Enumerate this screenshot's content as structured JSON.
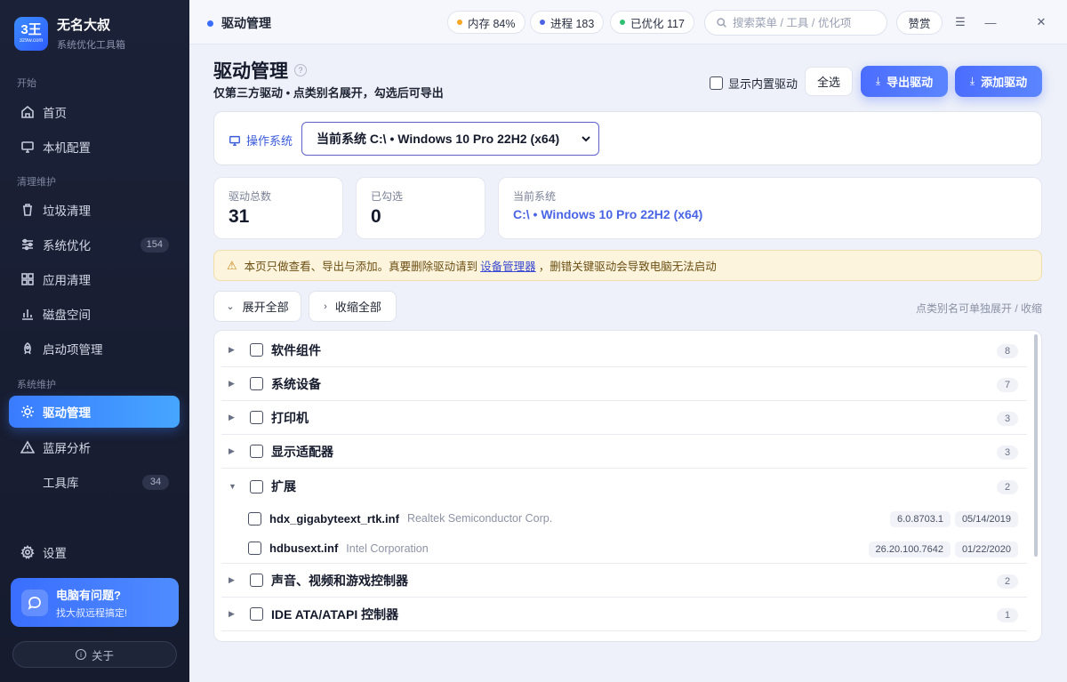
{
  "brand": {
    "logo_main": "3王",
    "logo_sub": "3z9w.com",
    "title": "无名大叔",
    "subtitle": "系统优化工具箱"
  },
  "sidebar": {
    "sections": [
      "开始",
      "清理维护",
      "系统维护"
    ],
    "items": [
      {
        "label": "首页",
        "icon": "home-icon"
      },
      {
        "label": "本机配置",
        "icon": "monitor-icon"
      },
      {
        "label": "垃圾清理",
        "icon": "trash-icon"
      },
      {
        "label": "系统优化",
        "icon": "sliders-icon",
        "badge": "154"
      },
      {
        "label": "应用清理",
        "icon": "grid-icon"
      },
      {
        "label": "磁盘空间",
        "icon": "bar-chart-icon"
      },
      {
        "label": "启动项管理",
        "icon": "rocket-icon"
      },
      {
        "label": "驱动管理",
        "icon": "chip-icon",
        "active": true
      },
      {
        "label": "蓝屏分析",
        "icon": "warning-icon"
      },
      {
        "label": "工具库",
        "badge": "34"
      },
      {
        "label": "设置",
        "icon": "gear-icon"
      }
    ],
    "help": {
      "title": "电脑有问题?",
      "subtitle": "找大叔远程搞定!"
    },
    "about": "关于"
  },
  "topbar": {
    "title": "驱动管理",
    "chips": [
      {
        "label": "内存 84%",
        "color": "#f5a623"
      },
      {
        "label": "进程 183",
        "color": "#4a63e6"
      },
      {
        "label": "已优化 117",
        "color": "#2fbf71"
      }
    ],
    "search_placeholder": "搜索菜单 / 工具 / 优化项",
    "donate": "赞赏",
    "menu_glyph": "☰",
    "minimize_glyph": "—",
    "close_glyph": "✕"
  },
  "page": {
    "title": "驱动管理",
    "help_glyph": "?",
    "subtitle": "仅第三方驱动 • 点类别名展开，勾选后可导出",
    "show_builtin": "显示内置驱动",
    "select_all": "全选",
    "export": "导出驱动",
    "add": "添加驱动"
  },
  "os": {
    "label": "操作系统",
    "selected": "当前系统 C:\\ • Windows 10 Pro 22H2 (x64)"
  },
  "stats": [
    {
      "label": "驱动总数",
      "value": "31"
    },
    {
      "label": "已勾选",
      "value": "0"
    },
    {
      "label": "当前系统",
      "value": "C:\\ • Windows 10 Pro 22H2 (x64)"
    }
  ],
  "warning": {
    "before": "本页只做查看、导出与添加。真要删除驱动请到",
    "link": "设备管理器",
    "after": "，删错关键驱动会导致电脑无法启动"
  },
  "toolbar": {
    "expand_all": "展开全部",
    "collapse_all": "收缩全部",
    "hint": "点类别名可单独展开 / 收缩"
  },
  "categories": [
    {
      "name": "软件组件",
      "count": "8"
    },
    {
      "name": "系统设备",
      "count": "7"
    },
    {
      "name": "打印机",
      "count": "3"
    },
    {
      "name": "显示适配器",
      "count": "3"
    },
    {
      "name": "扩展",
      "count": "2",
      "expanded": true
    },
    {
      "name": "声音、视频和游戏控制器",
      "count": "2"
    },
    {
      "name": "IDE ATA/ATAPI 控制器",
      "count": "1"
    }
  ],
  "drivers": [
    {
      "file": "hdx_gigabyteext_rtk.inf",
      "vendor": "Realtek Semiconductor Corp.",
      "version": "6.0.8703.1",
      "date": "05/14/2019"
    },
    {
      "file": "hdbusext.inf",
      "vendor": "Intel Corporation",
      "version": "26.20.100.7642",
      "date": "01/22/2020"
    }
  ],
  "colors": {
    "accent": "#4a6dff",
    "sidebar_bg": "#1b2137",
    "warning_bg": "#fdf4dd"
  }
}
